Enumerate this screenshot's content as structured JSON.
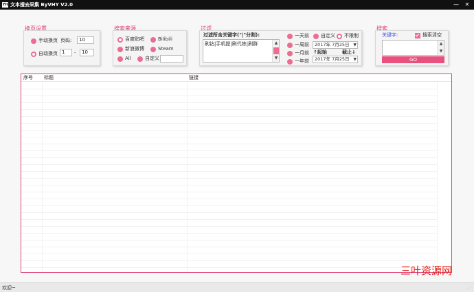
{
  "window": {
    "icon_text": "YH",
    "title": "文本搜去采集 ByVHY V2.0",
    "minimize": "—",
    "close": "✕"
  },
  "paging": {
    "label": "换页设置",
    "manual": "手动换页",
    "page_label": "页码:",
    "page_value": "10",
    "auto": "自动换页",
    "from_value": "1",
    "dash": "-",
    "to_value": "10"
  },
  "source": {
    "label": "搜索来源",
    "options": [
      "百度贴吧",
      "Bilibili",
      "新浪微博",
      "Steam",
      "All",
      "自定义"
    ],
    "custom_value": ""
  },
  "filter": {
    "label": "过滤",
    "keywords_label": "过滤所含关键字(\"|\"分割):",
    "keywords_value": "刷钻|手机提|刷代练|刷群",
    "time_options": [
      "一天前",
      "自定义",
      "不限制",
      "一周前",
      "一月前",
      "一年前"
    ],
    "start_label": "起始",
    "end_label": "截止",
    "start_date": "2017年 7月25日",
    "end_date": "2017年 7月25日"
  },
  "search": {
    "label": "搜索",
    "keyword_label": "关键字:",
    "clear_label": "搜索清空",
    "keyword_value": "",
    "go_label": "GO"
  },
  "table": {
    "columns": [
      "序号",
      "标题",
      "链接"
    ],
    "rows": []
  },
  "status": {
    "text": "欢迎~"
  },
  "watermark": "三叶资源网",
  "colors": {
    "accent": "#e8507e",
    "group_label": "#e0407a"
  }
}
